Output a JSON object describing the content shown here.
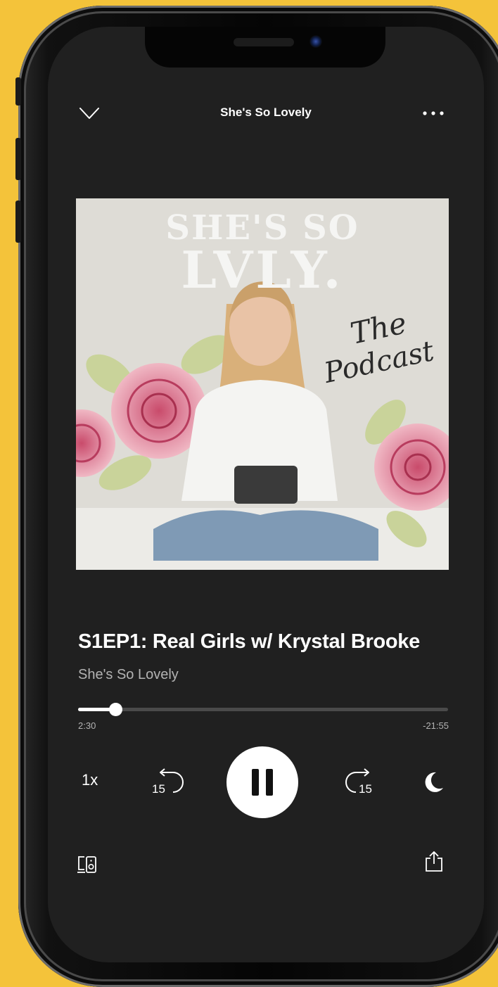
{
  "header": {
    "title": "She's So Lovely",
    "collapse_icon": "chevron-down-icon",
    "more_icon": "more-icon"
  },
  "cover": {
    "title_line1": "SHE'S SO",
    "title_line2": "LVLY.",
    "script_line1": "The",
    "script_line2": "Podcast"
  },
  "episode": {
    "title": "S1EP1: Real Girls w/ Krystal Brooke",
    "show": "She's So Lovely"
  },
  "progress": {
    "elapsed": "2:30",
    "remaining": "-21:55",
    "fraction": 0.1
  },
  "controls": {
    "speed": "1x",
    "skip_back": "15",
    "skip_forward": "15",
    "play_icon": "pause-icon",
    "sleep_icon": "moon-icon"
  },
  "footer": {
    "devices_icon": "devices-icon",
    "share_icon": "share-icon"
  },
  "colors": {
    "background": "#f4c33a",
    "screen": "#202020",
    "text": "#ffffff",
    "secondary_text": "#b3b3b3",
    "track": "#4a4a4a"
  }
}
